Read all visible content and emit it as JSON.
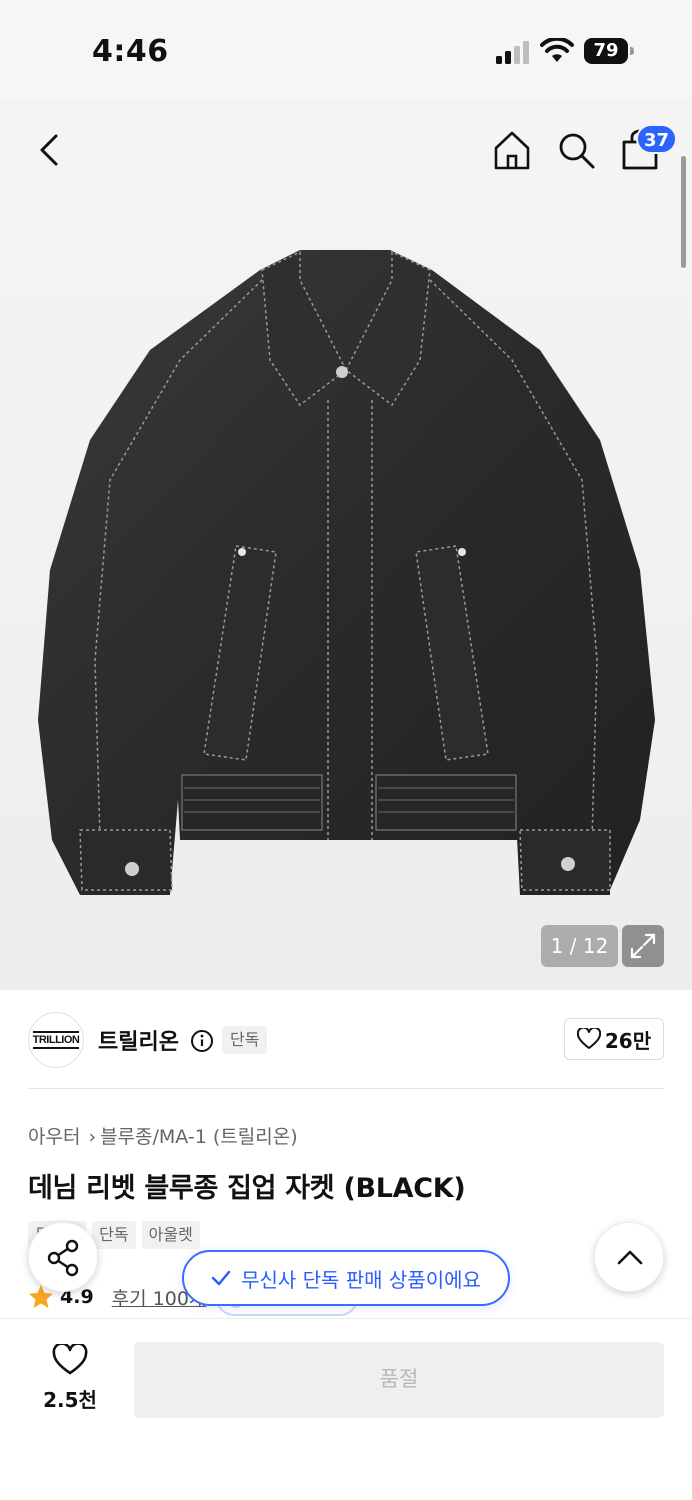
{
  "status_bar": {
    "time": "4:46",
    "battery": "79"
  },
  "header": {
    "cart_count": "37",
    "icons": [
      "back-icon",
      "home-icon",
      "search-icon",
      "cart-icon"
    ]
  },
  "gallery": {
    "pager": "1 / 12"
  },
  "brand": {
    "name": "트릴리온",
    "logo_text": "TRILLION",
    "exclusive_tag": "단독",
    "like_count": "26만"
  },
  "breadcrumb": {
    "category": "아우터",
    "subcategory": "블루종/MA-1 (트릴리온)"
  },
  "product": {
    "title": "데님 리벳 블루종 집업 자켓 (BLACK)"
  },
  "tags": [
    "무신사",
    "단독",
    "아울렛"
  ],
  "rating": {
    "score": "4.9",
    "reviews": "후기 100개"
  },
  "toast": {
    "text": "무신사 단독 판매 상품이에요"
  },
  "bottom_bar": {
    "wish_count": "2.5천",
    "buy_label": "품절"
  },
  "colors": {
    "accent": "#2b63ff",
    "star": "#f5a623"
  }
}
